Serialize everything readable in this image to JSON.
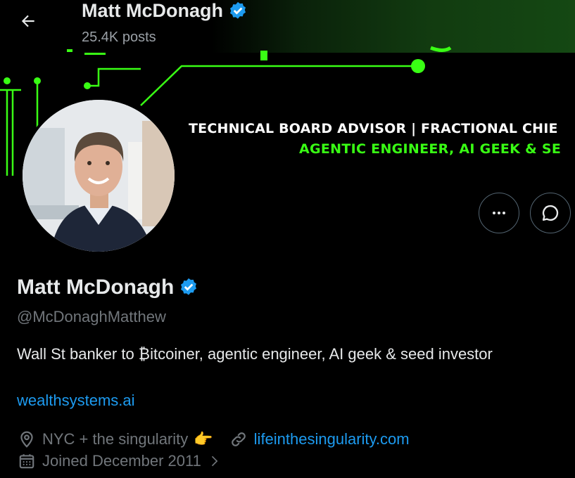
{
  "header": {
    "name": "Matt McDonagh",
    "posts": "25.4K posts"
  },
  "banner": {
    "line1": "TECHNICAL BOARD ADVISOR | FRACTIONAL CHIE",
    "line2": "AGENTIC ENGINEER, AI GEEK & SE"
  },
  "profile": {
    "name": "Matt McDonagh",
    "handle": "@McDonaghMatthew",
    "bio": "Wall St banker to ₿itcoiner, agentic engineer, AI geek & seed investor",
    "website": "wealthsystems.ai",
    "location": "NYC + the singularity",
    "location_emoji": "👉",
    "link": "lifeinthesingularity.com",
    "joined": "Joined December 2011"
  },
  "colors": {
    "accent": "#1d9bf0",
    "banner_green": "#39ff14",
    "verified": "#1d9bf0"
  },
  "icons": [
    "back-arrow-icon",
    "verified-icon",
    "more-icon",
    "message-icon",
    "location-icon",
    "link-icon",
    "calendar-icon",
    "chevron-right-icon"
  ]
}
